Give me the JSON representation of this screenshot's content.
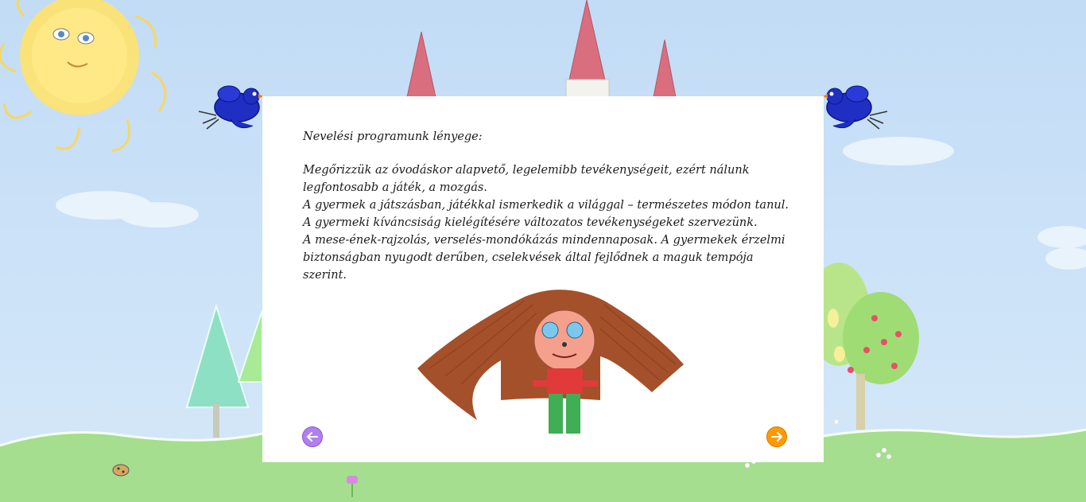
{
  "content": {
    "heading": "Nevelési programunk lényege:",
    "paragraphs": [
      "Megőrizzük az óvodáskor alapvető, legelemibb tevékenységeit, ezért nálunk legfontosabb a játék, a mozgás.",
      "A gyermek a játszásban, játékkal ismerkedik a világgal – természetes módon tanul. A gyermeki kíváncsiság kielégítésére változatos tevékenységeket szervezünk.",
      "A mese-ének-rajzolás, verselés-mondókázás mindennaposak. A gyermekek érzelmi biztonságban nyugodt derűben,  cselekvések által fejlődnek a maguk tempója szerint."
    ]
  },
  "navigation": {
    "prev_icon": "arrow-left-circle-icon",
    "next_icon": "arrow-right-circle-icon"
  },
  "colors": {
    "sky": "#c9e0f7",
    "grass": "#a5de8e",
    "panel": "#ffffff",
    "prev_button": "#b27ff0",
    "next_button": "#ff9a00",
    "bird": "#1f2fc4",
    "castle_roof": "#d96f7e"
  }
}
